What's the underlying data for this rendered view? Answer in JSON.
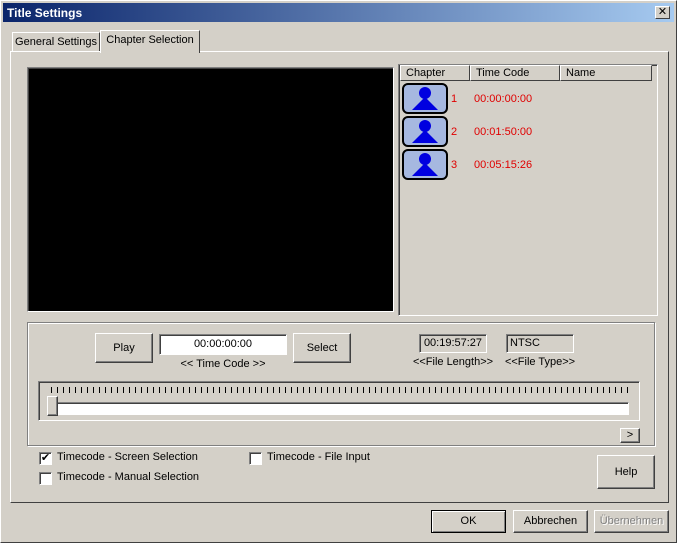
{
  "window": {
    "title": "Title Settings",
    "close_glyph": "✕"
  },
  "tabs": [
    {
      "label": "General Settings",
      "active": false
    },
    {
      "label": "Chapter Selection",
      "active": true
    }
  ],
  "chapter_list": {
    "columns": [
      "Chapter",
      "Time Code",
      "Name"
    ],
    "rows": [
      {
        "number": "1",
        "time": "00:00:00:00",
        "name": ""
      },
      {
        "number": "2",
        "time": "00:01:50:00",
        "name": ""
      },
      {
        "number": "3",
        "time": "00:05:15:26",
        "name": ""
      }
    ],
    "text_color": "#e00000",
    "thumb_icon": "person-icon"
  },
  "controls": {
    "play_label": "Play",
    "timecode_value": "00:00:00:00",
    "timecode_caption": "<< Time Code >>",
    "select_label": "Select",
    "file_length_value": "00:19:57:27",
    "file_length_caption": "<<File Length>>",
    "file_type_value": "NTSC",
    "file_type_caption": "<<File Type>>",
    "scroll_right_glyph": ">",
    "slider_position": 0.0
  },
  "options": {
    "screen_selection": {
      "label": "Timecode - Screen Selection",
      "checked": true
    },
    "manual_selection": {
      "label": "Timecode - Manual Selection",
      "checked": false
    },
    "file_input": {
      "label": "Timecode - File Input",
      "checked": false
    },
    "check_glyph": "✔"
  },
  "buttons": {
    "help": "Help",
    "ok": "OK",
    "cancel": "Abbrechen",
    "apply": "Übernehmen"
  },
  "colors": {
    "titlebar": "#0a246a",
    "face": "#d4d0c8",
    "preview": "#000000",
    "icon_blue": "#0000e0"
  }
}
